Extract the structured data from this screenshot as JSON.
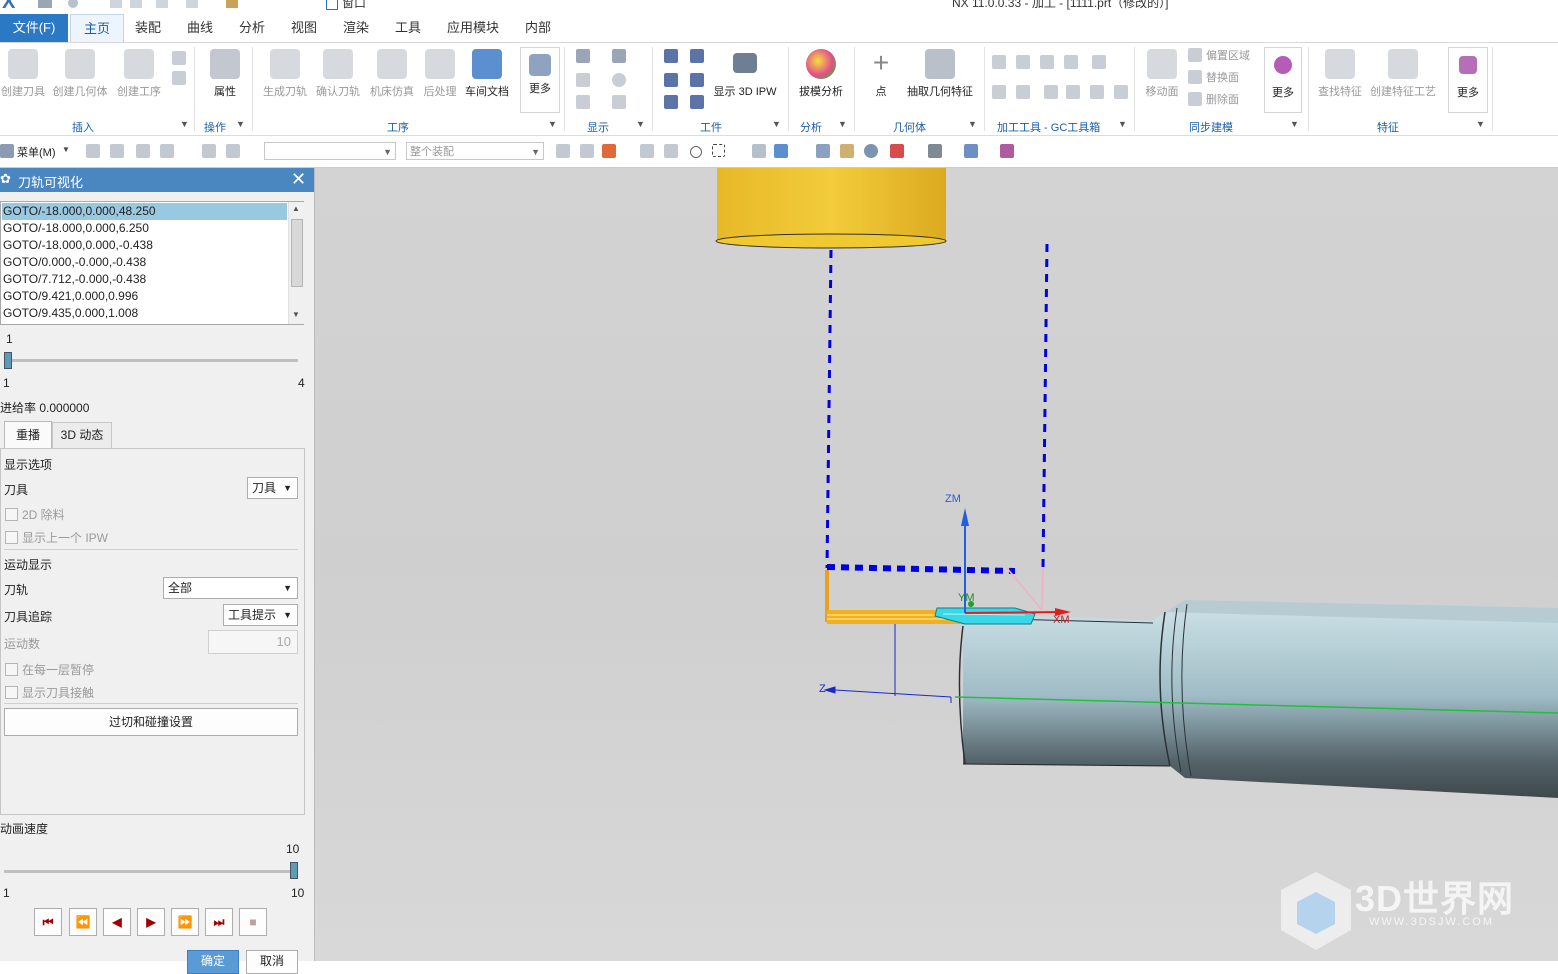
{
  "window": {
    "app_logo": "X",
    "title": "NX 11.0.0.33 - 加工 - [1111.prt（修改的）]",
    "quick_window_label": "窗口"
  },
  "menu_tabs": [
    "文件(F)",
    "主页",
    "装配",
    "曲线",
    "分析",
    "视图",
    "渲染",
    "工具",
    "应用模块",
    "内部"
  ],
  "ribbon": {
    "insert": {
      "buttons": [
        "创建刀具",
        "创建几何体",
        "创建工序"
      ],
      "group": "插入"
    },
    "operate": {
      "button": "属性",
      "group": "操作"
    },
    "process": {
      "buttons": [
        "生成刀轨",
        "确认刀轨",
        "机床仿真",
        "后处理",
        "车间文档",
        "更多"
      ],
      "group": "工序"
    },
    "display": {
      "group": "显示"
    },
    "workpiece": {
      "button": "显示 3D IPW",
      "group": "工件"
    },
    "analysis": {
      "button": "拔模分析",
      "group": "分析"
    },
    "geometry": {
      "buttons": [
        "点",
        "抽取几何特征"
      ],
      "group": "几何体"
    },
    "gc": {
      "group": "加工工具 - GC工具箱"
    },
    "sync": {
      "buttons": [
        "移动面",
        "偏置区域",
        "替换面",
        "删除面",
        "更多"
      ],
      "group": "同步建模"
    },
    "feature": {
      "buttons": [
        "查找特征",
        "创建特征工艺",
        "更多"
      ],
      "group": "特征"
    }
  },
  "toolbar": {
    "menu_label": "菜单(M)",
    "filter_placeholder": "",
    "scope_value": "整个装配"
  },
  "panel": {
    "title": "刀轨可视化",
    "close": "✕",
    "list": [
      "GOTO/-18.000,0.000,48.250",
      "GOTO/-18.000,0.000,6.250",
      "GOTO/-18.000,0.000,-0.438",
      "GOTO/0.000,-0.000,-0.438",
      "GOTO/7.712,-0.000,-0.438",
      "GOTO/9.421,0.000,0.996",
      "GOTO/9.435,0.000,1.008"
    ],
    "selected_index": 0,
    "step_slider": {
      "value": "1",
      "min": "1",
      "max": "4",
      "position": 0.0
    },
    "feed_rate": "进给率 0.000000",
    "tabs": [
      "重播",
      "3D 动态"
    ],
    "display_options": {
      "heading": "显示选项",
      "tool_label": "刀具",
      "tool_value": "刀具",
      "cb_2d_removal": "2D 除料",
      "cb_prev_ipw": "显示上一个 IPW"
    },
    "motion_display": {
      "heading": "运动显示",
      "path_label": "刀轨",
      "path_value": "全部",
      "trace_label": "刀具追踪",
      "trace_value": "工具提示",
      "count_label": "运动数",
      "count_value": "10",
      "cb_pause_layer": "在每一层暂停",
      "cb_show_contact": "显示刀具接触"
    },
    "gouge_button": "过切和碰撞设置",
    "anim_speed": {
      "label": "动画速度",
      "value": "10",
      "min": "1",
      "max": "10",
      "position": 1.0
    },
    "playback": [
      "⏮",
      "⏪",
      "◀",
      "▶",
      "⏩",
      "⏭",
      "■"
    ],
    "ok": "确定",
    "cancel": "取消"
  },
  "viewport": {
    "axis_labels": {
      "zm": "ZM",
      "ym": "YM",
      "xm": "XM",
      "z": "Z"
    },
    "watermark": {
      "text": "3D世界网",
      "url": "WWW.3DSJW.COM"
    }
  },
  "colors": {
    "accent": "#2b78c5",
    "panel_header": "#4a86c0",
    "toolpath": "#0000e0",
    "tool_yellow": "#f0c830",
    "part": "#8fb0bb"
  }
}
